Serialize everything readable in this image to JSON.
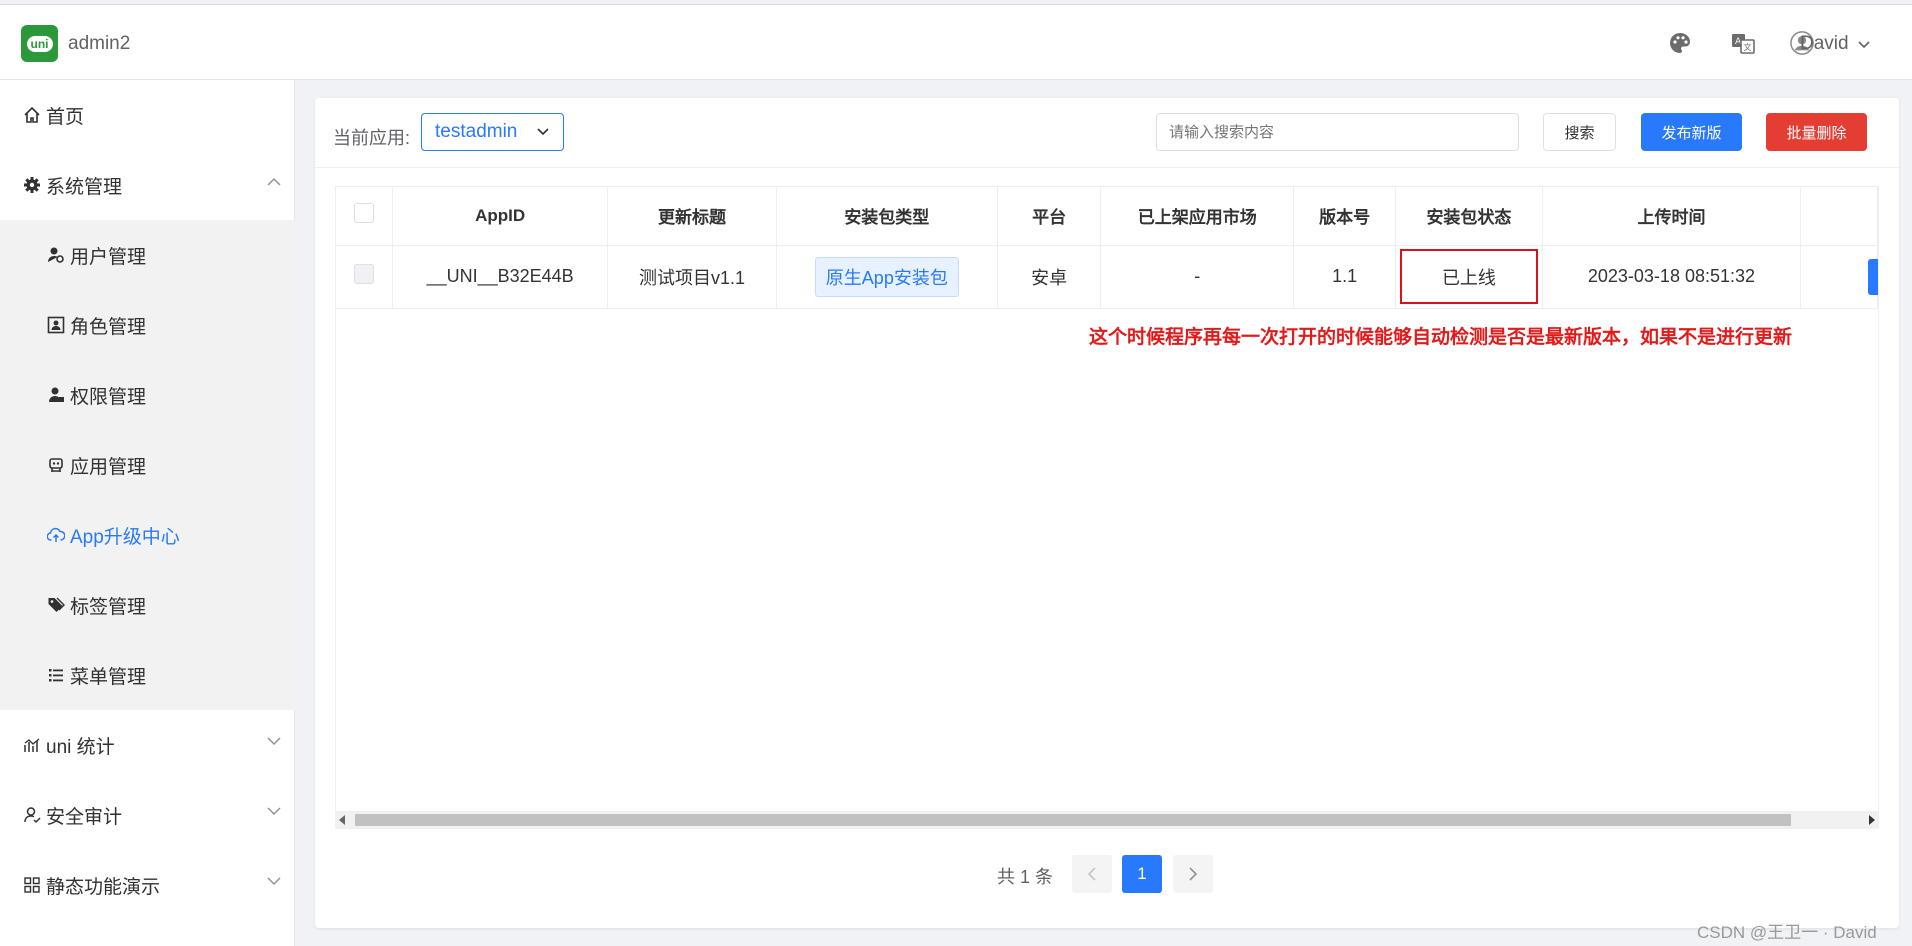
{
  "header": {
    "logo_text": "uni",
    "app_name": "admin2",
    "user_name": "David"
  },
  "sidebar": {
    "items": [
      {
        "label": "首页",
        "icon": "home-icon"
      },
      {
        "label": "系统管理",
        "icon": "gear-icon"
      },
      {
        "label": "用户管理",
        "icon": "user-settings-icon"
      },
      {
        "label": "角色管理",
        "icon": "role-icon"
      },
      {
        "label": "权限管理",
        "icon": "permission-icon"
      },
      {
        "label": "应用管理",
        "icon": "app-icon"
      },
      {
        "label": "App升级中心",
        "icon": "cloud-upload-icon"
      },
      {
        "label": "标签管理",
        "icon": "tag-icon"
      },
      {
        "label": "菜单管理",
        "icon": "list-icon"
      },
      {
        "label": "uni 统计",
        "icon": "chart-icon"
      },
      {
        "label": "安全审计",
        "icon": "audit-icon"
      },
      {
        "label": "静态功能演示",
        "icon": "grid-icon"
      }
    ]
  },
  "toolbar": {
    "current_app_label": "当前应用:",
    "current_app_value": "testadmin",
    "search_placeholder": "请输入搜索内容",
    "search_label": "搜索",
    "publish_label": "发布新版",
    "batch_delete_label": "批量删除"
  },
  "table": {
    "headers": [
      "AppID",
      "更新标题",
      "安装包类型",
      "平台",
      "已上架应用市场",
      "版本号",
      "安装包状态",
      "上传时间"
    ],
    "rows": [
      {
        "appid": "__UNI__B32E44B",
        "title": "测试项目v1.1",
        "package_type": "原生App安装包",
        "platform": "安卓",
        "store": "-",
        "version": "1.1",
        "status": "已上线",
        "upload_time": "2023-03-18 08:51:32"
      }
    ]
  },
  "annotation": "这个时候程序再每一次打开的时候能够自动检测是否是最新版本，如果不是进行更新",
  "pagination": {
    "total_label": "共 1 条",
    "current_page": "1"
  },
  "watermark": "CSDN @王卫一 · David",
  "colors": {
    "primary": "#2979ff",
    "danger": "#e43d33",
    "annotation": "#e11b1b",
    "logo": "#2b9939"
  }
}
